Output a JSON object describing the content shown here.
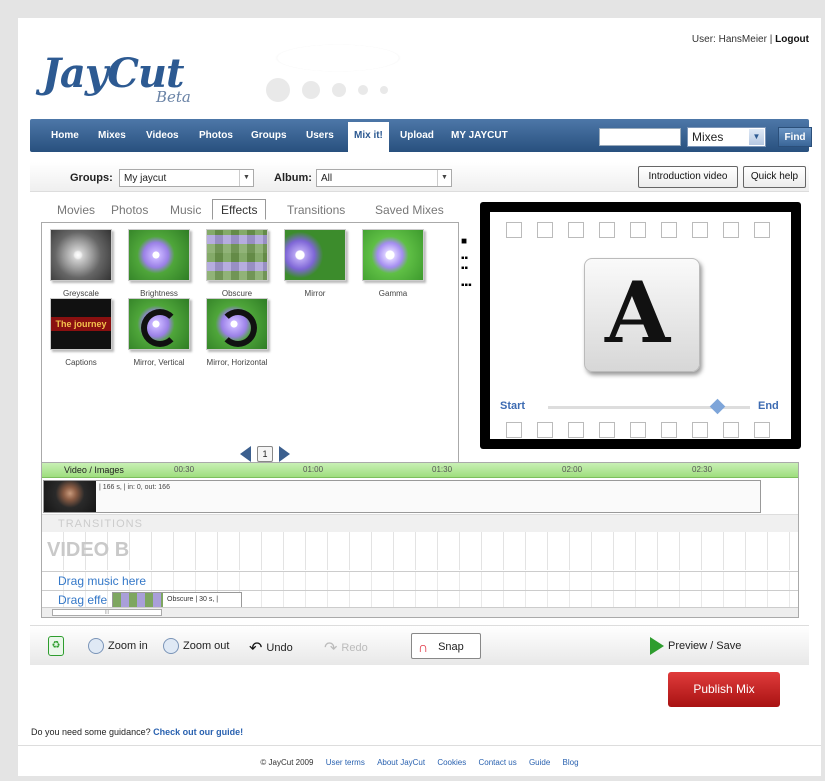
{
  "header": {
    "logo": "JayCut",
    "logo_sub": "Beta",
    "user_label": "User: HansMeier",
    "separator": "|",
    "logout": "Logout"
  },
  "nav": {
    "items": [
      {
        "label": "Home"
      },
      {
        "label": "Mixes"
      },
      {
        "label": "Videos"
      },
      {
        "label": "Photos"
      },
      {
        "label": "Groups"
      },
      {
        "label": "Users"
      },
      {
        "label": "Mix it!"
      },
      {
        "label": "Upload"
      },
      {
        "label": "MY JAYCUT"
      }
    ],
    "search_placeholder": "",
    "search_scope": "Mixes",
    "find": "Find"
  },
  "filters": {
    "groups_label": "Groups:",
    "groups_value": "My jaycut",
    "album_label": "Album:",
    "album_value": "All",
    "intro_video": "Introduction video",
    "quick_help": "Quick help"
  },
  "library": {
    "tabs": [
      "Movies",
      "Photos",
      "Music",
      "Effects",
      "Transitions",
      "Saved Mixes"
    ],
    "active_tab": "Effects",
    "effects": [
      {
        "name": "Greyscale"
      },
      {
        "name": "Brightness"
      },
      {
        "name": "Obscure"
      },
      {
        "name": "Mirror"
      },
      {
        "name": "Gamma"
      },
      {
        "name": "Captions",
        "thumb_text": "The journey"
      },
      {
        "name": "Mirror, Vertical"
      },
      {
        "name": "Mirror, Horizontal"
      }
    ],
    "page": "1"
  },
  "preview": {
    "glyph": "A",
    "start_label": "Start",
    "end_label": "End",
    "slider_position": 0.83
  },
  "timeline": {
    "track_label": "Video / Images",
    "ticks": [
      "00:30",
      "01:00",
      "01:30",
      "02:00",
      "02:30"
    ],
    "video_clip_info": "| 166 s, | in: 0, out: 166",
    "transitions_label": "TRANSITIONS",
    "video_b_label": "VIDEO B",
    "music_drop": "Drag music here",
    "effects_drop": "Drag effe",
    "effect_clip_info": "Obscure | 30 s, |",
    "scroll_mark": "III"
  },
  "toolbar": {
    "zoom_in": "Zoom in",
    "zoom_out": "Zoom out",
    "undo": "Undo",
    "redo": "Redo",
    "snap": "Snap",
    "preview_save": "Preview / Save"
  },
  "publish": "Publish Mix",
  "guide": {
    "text": "Do you need some guidance?",
    "link": "Check out our guide!"
  },
  "footer": {
    "copyright": "© JayCut 2009",
    "links": [
      "User terms",
      "About JayCut",
      "Cookies",
      "Contact us",
      "Guide",
      "Blog"
    ]
  },
  "colors": {
    "nav_blue": "#2d5a92",
    "link_blue": "#2a62b0",
    "timeline_green": "#9ede7e",
    "publish_red": "#c42020"
  }
}
